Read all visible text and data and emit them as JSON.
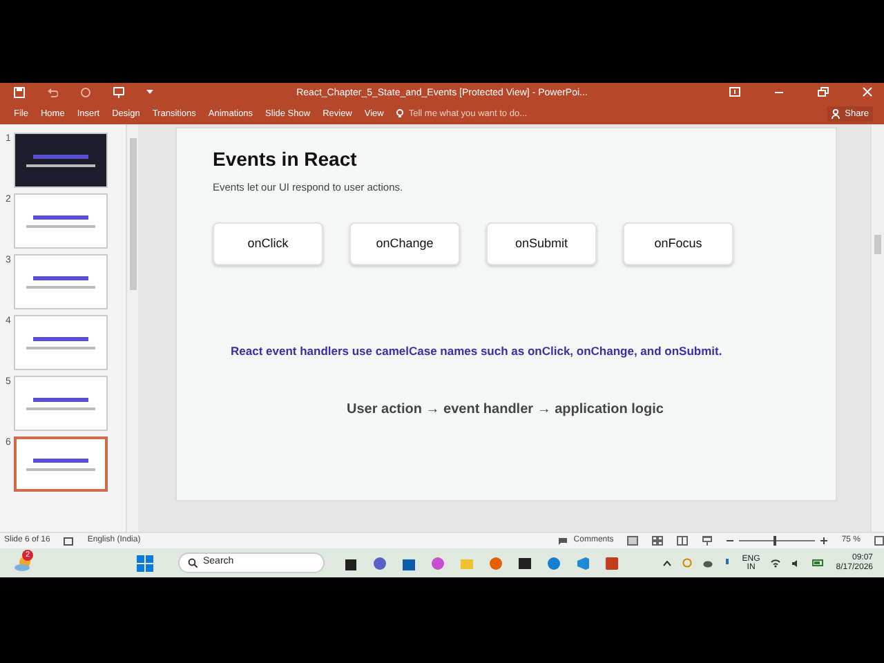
{
  "window": {
    "title": "React_Chapter_5_State_and_Events [Protected View] - PowerPoi..."
  },
  "menu": [
    "File",
    "Home",
    "Insert",
    "Design",
    "Transitions",
    "Animations",
    "Slide Show",
    "Review",
    "View"
  ],
  "tell_me": {
    "placeholder": "Tell me what you want to do..."
  },
  "share": "Share",
  "thumbnails": [
    {
      "number": "1",
      "kind": "dark",
      "selected": false
    },
    {
      "number": "2",
      "kind": "light",
      "selected": false
    },
    {
      "number": "3",
      "kind": "light",
      "selected": false
    },
    {
      "number": "4",
      "kind": "light",
      "selected": false
    },
    {
      "number": "5",
      "kind": "light",
      "selected": false
    },
    {
      "number": "6",
      "kind": "light",
      "selected": true
    }
  ],
  "slide": {
    "title": "Events in React",
    "subtitle": "Events let our UI respond to user actions.",
    "events": [
      "onClick",
      "onChange",
      "onSubmit",
      "onFocus"
    ],
    "note": "React event handlers use camelCase names such as onClick, onChange, and onSubmit.",
    "flow": "User action → event handler → application logic"
  },
  "status_bar": {
    "slide_info": "Slide 6 of 16",
    "language": "English (India)",
    "comments": "Comments",
    "zoom": {
      "level": 0.45,
      "reading": "75 %"
    }
  },
  "taskbar": {
    "weather_badge": "2",
    "search": {
      "placeholder": "Search"
    },
    "language": [
      "ENG",
      "IN"
    ],
    "time": "09:07",
    "date": "8/17/2026"
  }
}
